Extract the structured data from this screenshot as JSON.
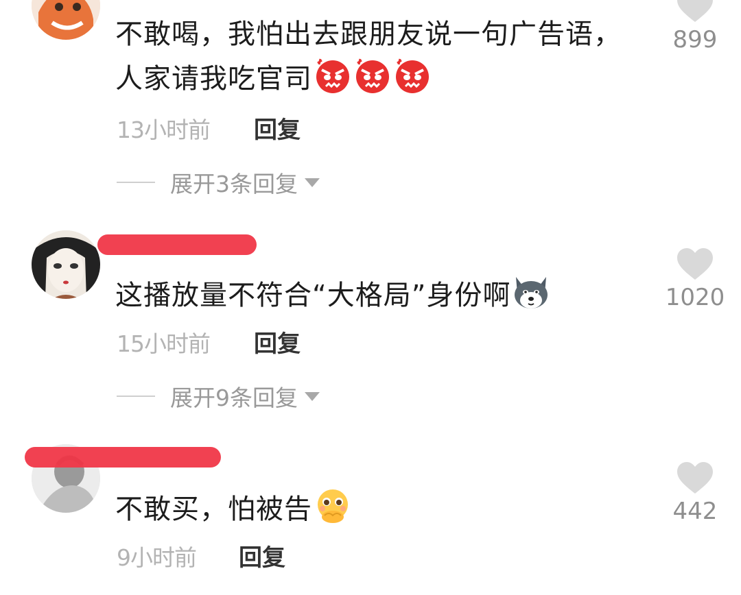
{
  "comments": [
    {
      "text": "不敢喝，我怕出去跟朋友说一句广告语，人家请我吃官司",
      "text_line1": "不敢喝，我怕出去跟朋友说一句广告语，",
      "text_line2": "人家请我吃官司",
      "emojis": [
        "angry-face-icon",
        "angry-face-icon",
        "angry-face-icon"
      ],
      "time": "13小时前",
      "reply_label": "回复",
      "expand_label": "展开3条回复",
      "likes": "899"
    },
    {
      "text": "这播放量不符合“大格局”身份啊",
      "emojis": [
        "husky-dog-icon"
      ],
      "time": "15小时前",
      "reply_label": "回复",
      "expand_label": "展开9条回复",
      "likes": "1020"
    },
    {
      "text": "不敢买，怕被告",
      "emojis": [
        "pleading-face-hands-icon"
      ],
      "time": "9小时前",
      "reply_label": "回复",
      "likes": "442"
    }
  ],
  "colors": {
    "redaction": "#f0394a",
    "like_icon": "#d9d9d9",
    "meta_text": "#b3b3b3"
  }
}
